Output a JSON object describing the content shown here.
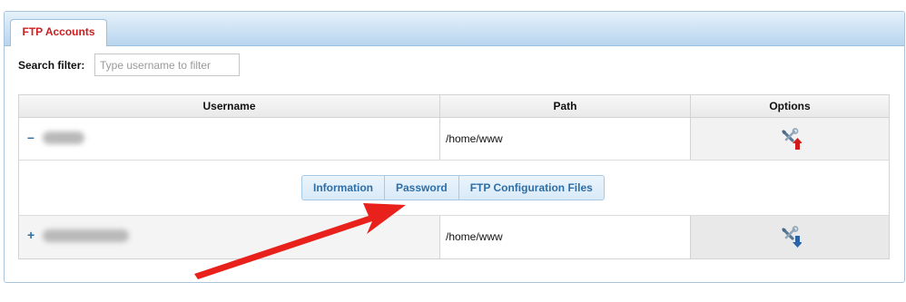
{
  "tabs": [
    {
      "label": "FTP Accounts",
      "active": true
    }
  ],
  "search": {
    "label": "Search filter:",
    "placeholder": "Type username to filter",
    "value": ""
  },
  "table": {
    "columns": [
      "Username",
      "Path",
      "Options"
    ],
    "rows": [
      {
        "toggle": "–",
        "username": "",
        "path": "/home/www",
        "option_icon": "tools-upload-icon",
        "expanded": true
      },
      {
        "toggle": "+",
        "username": "",
        "path": "/home/www",
        "option_icon": "tools-download-icon",
        "expanded": false
      }
    ],
    "subtabs": [
      "Information",
      "Password",
      "FTP Configuration Files"
    ]
  },
  "colors": {
    "accent_red": "#cc1f1f",
    "link_blue": "#2e6ea6",
    "arrow_red": "#e8211c"
  }
}
